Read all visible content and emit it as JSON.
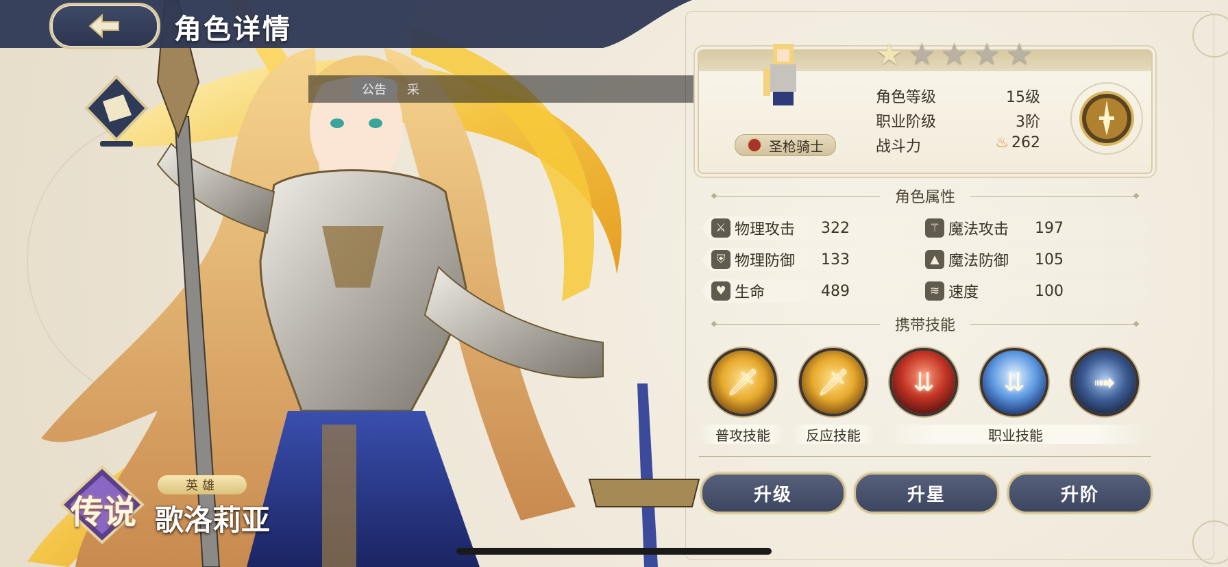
{
  "header": {
    "title": "角色详情"
  },
  "notice": {
    "tag": "公告",
    "text": "采"
  },
  "character": {
    "stars_total": 5,
    "stars_filled": 1,
    "class_name": "圣枪骑士",
    "rarity_label": "传说",
    "type_label": "英雄",
    "name": "歌洛莉亚"
  },
  "info": {
    "rows": [
      {
        "label": "角色等级",
        "value": "15级"
      },
      {
        "label": "职业阶级",
        "value": "3阶"
      },
      {
        "label": "战斗力",
        "value": "262"
      }
    ]
  },
  "attributes": {
    "title": "角色属性",
    "rows": [
      [
        {
          "icon": "sword-icon",
          "name": "物理攻击",
          "value": "322"
        },
        {
          "icon": "wand-icon",
          "name": "魔法攻击",
          "value": "197"
        }
      ],
      [
        {
          "icon": "shield-icon",
          "name": "物理防御",
          "value": "133"
        },
        {
          "icon": "hat-icon",
          "name": "魔法防御",
          "value": "105"
        }
      ],
      [
        {
          "icon": "heart-icon",
          "name": "生命",
          "value": "489"
        },
        {
          "icon": "wing-icon",
          "name": "速度",
          "value": "100"
        }
      ]
    ]
  },
  "skills": {
    "title": "携带技能",
    "labels": {
      "normal": "普攻技能",
      "reaction": "反应技能",
      "class": "职业技能"
    }
  },
  "actions": {
    "upgrade": "升级",
    "star_up": "升星",
    "rank_up": "升阶"
  },
  "colors": {
    "panel_bg": "#f2ecdc",
    "button_bg": "#3d4660",
    "gold": "#d9cba6",
    "header_bg": "#2c3550"
  }
}
